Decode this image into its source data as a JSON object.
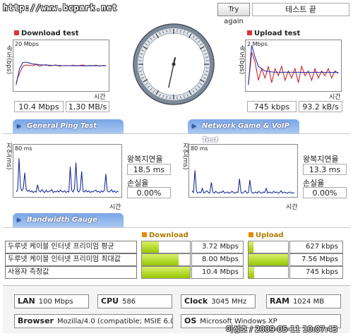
{
  "url_text": "http://www.bcpark.net",
  "try_again_label": "Try again",
  "status_text": "테스트 끝",
  "download": {
    "title": "Download test",
    "y_axis_label": "속도(bps)",
    "scale": "20 Mbps",
    "x_axis_label": "시간",
    "mbps": "10.4 Mbps",
    "mbytes": "1.30 MB/s"
  },
  "upload": {
    "title": "Upload test",
    "y_axis_label": "속도(bps)",
    "scale": "2 Mbps",
    "x_axis_label": "시간",
    "kbps": "745 kbps",
    "kbytes": "93.2 kB/s"
  },
  "tabs": {
    "ping": "General Ping Test",
    "game": "Network Game & VoIP Test",
    "bandwidth": "Bandwidth Gauge"
  },
  "ping": {
    "y_axis_label": "지연(ms)",
    "scale": "80 ms",
    "x_axis_label": "시간",
    "rtt_label": "왕복지연율",
    "rtt_value": "18.5 ms",
    "loss_label": "손실율",
    "loss_value": "0.00%"
  },
  "game": {
    "y_axis_label": "지연(ms)",
    "scale": "80 ms",
    "x_axis_label": "시간",
    "rtt_label": "왕복지연율",
    "rtt_value": "13.3 ms",
    "loss_label": "손실율",
    "loss_value": "0.00%"
  },
  "gauge": {
    "download_header": "Download",
    "upload_header": "Upload",
    "rows": [
      {
        "label": "두루넷 케이블 인터넷 프리미엄 평균",
        "down_value": "3.72 Mbps",
        "down_fill": 0.36,
        "up_value": "627 kbps",
        "up_fill": 0.12
      },
      {
        "label": "두루넷 케이블 인터넷 프리미엄 최대값",
        "down_value": "8.00 Mbps",
        "down_fill": 0.77,
        "up_value": "7.56 Mbps",
        "up_fill": 1.0
      },
      {
        "label": "사용자 측정값",
        "down_value": "10.4 Mbps",
        "down_fill": 1.0,
        "up_value": "745 kbps",
        "up_fill": 0.14
      }
    ]
  },
  "system": {
    "lan_label": "LAN",
    "lan_value": "100 Mbps",
    "cpu_label": "CPU",
    "cpu_value": "586",
    "clock_label": "Clock",
    "clock_value": "3045 MHz",
    "ram_label": "RAM",
    "ram_value": "1024 MB",
    "browser_label": "Browser",
    "browser_value": "Mozilla/4.0 (compatible; MSIE 6.0",
    "os_label": "OS",
    "os_value": "Microsoft Windows XP"
  },
  "watermark": "이성호 / 2009-05-11 10:07:43",
  "colors": {
    "download_line_red": "#cc2222",
    "download_line_blue": "#2233aa",
    "tab_blue": "#7aa6e6",
    "gauge_green": "#99c700",
    "ping_line": "#1a2a9a"
  },
  "speed_dial": {
    "pointer_value": 10.4,
    "scale_max": 20
  },
  "chart_data": [
    {
      "type": "line",
      "title": "Download test",
      "ylabel": "속도(bps)",
      "xlabel": "시간",
      "ylim": [
        0,
        20
      ],
      "series": [
        {
          "color": "#cc2222",
          "values": [
            3,
            7,
            10,
            10.6,
            10.4,
            10.3,
            10.8,
            10.1,
            10.5,
            10.7,
            10.2,
            10.4,
            10.6,
            10.1,
            10.3,
            10.4,
            10.2,
            10.5,
            10.3,
            10.4,
            10.6,
            10.2,
            10.4,
            10.3,
            10.5,
            10.1,
            10.4,
            10.3
          ]
        },
        {
          "color": "#2233aa",
          "values": [
            2,
            9,
            11.6,
            11.8,
            11.4,
            11.0,
            10.9,
            10.7,
            10.6,
            10.5,
            10.5,
            10.4,
            10.4,
            10.4,
            10.3,
            10.3,
            10.3,
            10.3,
            10.2,
            10.3,
            10.2,
            10.2,
            10.3,
            10.2,
            10.3,
            10.2,
            10.3,
            10.2
          ]
        }
      ]
    },
    {
      "type": "line",
      "title": "Upload test",
      "ylabel": "속도(bps)",
      "xlabel": "시간",
      "ylim": [
        0,
        2
      ],
      "series": [
        {
          "color": "#cc2222",
          "values": [
            0.2,
            1.6,
            1.2,
            0.4,
            0.9,
            0.5,
            1.0,
            0.3,
            0.9,
            0.6,
            1.0,
            0.4,
            0.8,
            0.5,
            0.9,
            0.3,
            1.0,
            0.6,
            0.8,
            0.4,
            0.9,
            0.5,
            0.8,
            0.6,
            0.9,
            0.5,
            0.8,
            0.7
          ]
        },
        {
          "color": "#2233aa",
          "values": [
            0.2,
            1.9,
            1.4,
            1.0,
            0.9,
            0.8,
            0.78,
            0.76,
            0.75,
            0.75,
            0.74,
            0.75,
            0.74,
            0.75,
            0.74,
            0.75,
            0.74,
            0.74,
            0.75,
            0.74,
            0.75,
            0.74,
            0.75,
            0.74,
            0.75,
            0.74,
            0.75,
            0.74
          ]
        }
      ]
    },
    {
      "type": "line",
      "title": "General Ping Test",
      "ylabel": "지연(ms)",
      "xlabel": "시간",
      "ylim": [
        0,
        80
      ],
      "series": [
        {
          "color": "#1a2a9a",
          "values": [
            6,
            10,
            62,
            14,
            8,
            12,
            38,
            10,
            7,
            9,
            6,
            8,
            5,
            7,
            6,
            18,
            8,
            6,
            10,
            7,
            5,
            9,
            6,
            7,
            8,
            10,
            5,
            7,
            6,
            8,
            6,
            9,
            7,
            6,
            8,
            5,
            7,
            6,
            48,
            9,
            6,
            12,
            55,
            8,
            6,
            10,
            40,
            7,
            6,
            9,
            6,
            8,
            5,
            7,
            6,
            8,
            9,
            6,
            7,
            5,
            8,
            6,
            9,
            36,
            8,
            6,
            7,
            10,
            6,
            8,
            5,
            7,
            6
          ]
        }
      ]
    },
    {
      "type": "line",
      "title": "Network Game & VoIP Test",
      "ylabel": "지연(ms)",
      "xlabel": "시간",
      "ylim": [
        0,
        80
      ],
      "series": [
        {
          "color": "#1a2a9a",
          "values": [
            8,
            5,
            42,
            7,
            4,
            6,
            5,
            12,
            4,
            6,
            8,
            5,
            4,
            22,
            6,
            4,
            7,
            5,
            4,
            6,
            5,
            8,
            4,
            5,
            6,
            4,
            5,
            7,
            5,
            4,
            6,
            5,
            28,
            5,
            4,
            6,
            8,
            4,
            5,
            26,
            6,
            4,
            5,
            6,
            4,
            7,
            5,
            4,
            6,
            5,
            12,
            4,
            6,
            5,
            4,
            7,
            5,
            6,
            4,
            5,
            8,
            4,
            6,
            5,
            4,
            5,
            6,
            4,
            5,
            4
          ]
        }
      ]
    }
  ]
}
